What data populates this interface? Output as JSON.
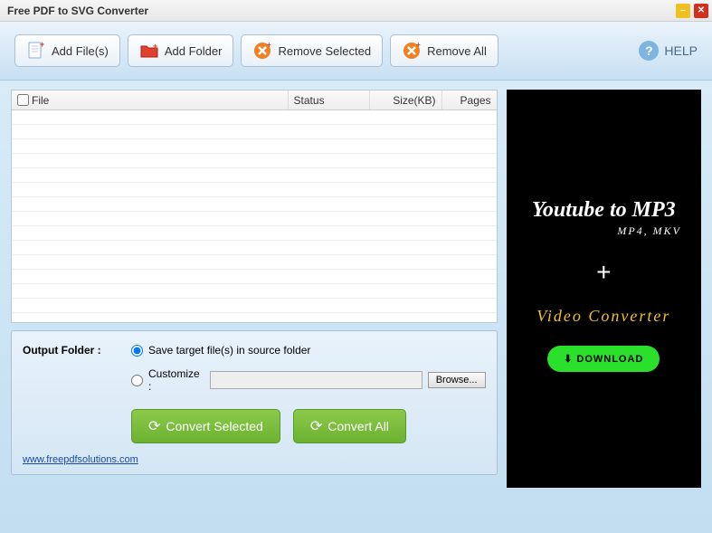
{
  "window": {
    "title": "Free PDF to SVG Converter"
  },
  "toolbar": {
    "add_files": "Add File(s)",
    "add_folder": "Add Folder",
    "remove_selected": "Remove Selected",
    "remove_all": "Remove All",
    "help": "HELP"
  },
  "table": {
    "headers": {
      "file": "File",
      "status": "Status",
      "size": "Size(KB)",
      "pages": "Pages"
    },
    "rows": []
  },
  "output": {
    "label": "Output Folder :",
    "opt_source": "Save target file(s) in source folder",
    "opt_customize": "Customize :",
    "custom_path": "",
    "browse": "Browse...",
    "convert_selected": "Convert Selected",
    "convert_all": "Convert All"
  },
  "footer": {
    "link": "www.freepdfsolutions.com"
  },
  "ad": {
    "title": "Youtube to MP3",
    "sub": "MP4, MKV",
    "plus": "+",
    "video": "Video Converter",
    "download": "DOWNLOAD"
  }
}
